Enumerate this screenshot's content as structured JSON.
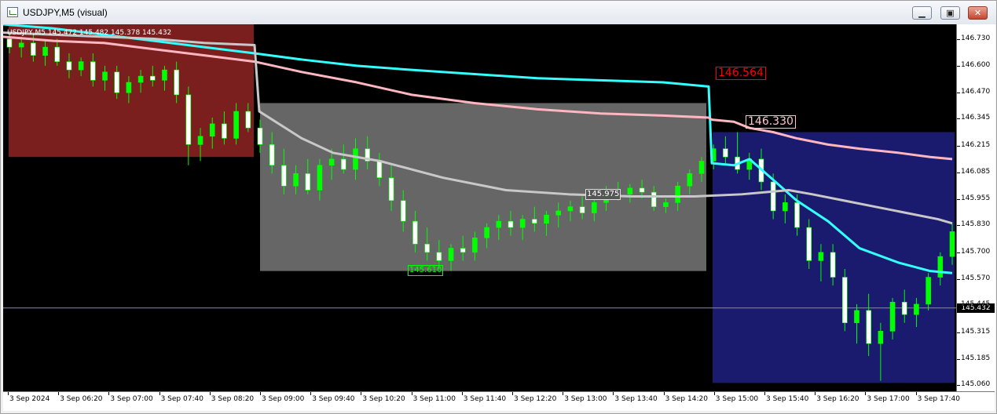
{
  "window": {
    "title": "USDJPY,M5 (visual)",
    "minimize": "▁",
    "restore": "▣",
    "close": "✕"
  },
  "chart": {
    "header": "USDJPY,M5  145.472 145.482 145.378 145.432",
    "current_price": "145.432",
    "labels": {
      "high_left": "146.564",
      "high_right": "146.330",
      "mid": "145.975",
      "low": "145.610"
    }
  },
  "colors": {
    "background": "#000000",
    "bull_candle": "#00ff00",
    "bear_candle": "#ffffff",
    "box_red": "#7a1e1e",
    "box_gray": "#666666",
    "box_blue": "#1a1a6e",
    "ma_cyan": "#33ffff",
    "ma_pink": "#ffb6c1",
    "ma_gray": "#c8c8c8",
    "label_red": "#ff0000"
  },
  "chart_data": {
    "type": "candlestick",
    "symbol": "USDJPY",
    "timeframe": "M5",
    "price_ticks": [
      "146.730",
      "146.600",
      "146.470",
      "146.345",
      "146.215",
      "146.085",
      "145.955",
      "145.830",
      "145.700",
      "145.570",
      "145.445",
      "145.315",
      "145.185",
      "145.060"
    ],
    "time_ticks": [
      "3 Sep 2024",
      "3 Sep 06:20",
      "3 Sep 07:00",
      "3 Sep 07:40",
      "3 Sep 08:20",
      "3 Sep 09:00",
      "3 Sep 09:40",
      "3 Sep 10:20",
      "3 Sep 11:00",
      "3 Sep 11:40",
      "3 Sep 12:20",
      "3 Sep 13:00",
      "3 Sep 13:40",
      "3 Sep 14:20",
      "3 Sep 15:00",
      "3 Sep 15:40",
      "3 Sep 16:20",
      "3 Sep 17:00",
      "3 Sep 17:40"
    ],
    "ylim": [
      145.03,
      146.8
    ],
    "current_price": 145.432,
    "levels": {
      "high_left": 146.564,
      "high_right": 146.33,
      "mid": 145.975,
      "low": 145.61
    },
    "series": [
      {
        "name": "cyan MA",
        "values": [
          146.8,
          146.78,
          146.75,
          146.72,
          146.69,
          146.66,
          146.63,
          146.6,
          146.58,
          146.56,
          146.54,
          146.53,
          146.52,
          146.5,
          146.13,
          146.12,
          146.15,
          146.05,
          145.95,
          145.85,
          145.72,
          145.65,
          145.61,
          145.6
        ]
      },
      {
        "name": "pink MA",
        "values": [
          146.74,
          146.72,
          146.71,
          146.68,
          146.65,
          146.62,
          146.57,
          146.52,
          146.46,
          146.42,
          146.39,
          146.37,
          146.36,
          146.35,
          146.34,
          146.33,
          146.3,
          146.28,
          146.25,
          146.22,
          146.2,
          146.18,
          146.16,
          146.15
        ]
      },
      {
        "name": "gray MA",
        "values": [
          146.76,
          146.75,
          146.74,
          146.73,
          146.71,
          146.7,
          146.38,
          146.25,
          146.18,
          146.14,
          146.06,
          146.0,
          145.98,
          145.97,
          145.97,
          145.98,
          145.99,
          146.0,
          145.98,
          145.95,
          145.92,
          145.89,
          145.86,
          145.84
        ]
      }
    ],
    "candles": [
      {
        "o": 146.73,
        "h": 146.76,
        "l": 146.66,
        "c": 146.69
      },
      {
        "o": 146.69,
        "h": 146.74,
        "l": 146.64,
        "c": 146.71
      },
      {
        "o": 146.71,
        "h": 146.75,
        "l": 146.62,
        "c": 146.65
      },
      {
        "o": 146.65,
        "h": 146.72,
        "l": 146.6,
        "c": 146.69
      },
      {
        "o": 146.69,
        "h": 146.73,
        "l": 146.6,
        "c": 146.62
      },
      {
        "o": 146.62,
        "h": 146.66,
        "l": 146.54,
        "c": 146.58
      },
      {
        "o": 146.58,
        "h": 146.64,
        "l": 146.55,
        "c": 146.62
      },
      {
        "o": 146.62,
        "h": 146.66,
        "l": 146.5,
        "c": 146.53
      },
      {
        "o": 146.53,
        "h": 146.6,
        "l": 146.48,
        "c": 146.57
      },
      {
        "o": 146.57,
        "h": 146.6,
        "l": 146.44,
        "c": 146.47
      },
      {
        "o": 146.47,
        "h": 146.55,
        "l": 146.42,
        "c": 146.52
      },
      {
        "o": 146.52,
        "h": 146.58,
        "l": 146.47,
        "c": 146.55
      },
      {
        "o": 146.55,
        "h": 146.6,
        "l": 146.5,
        "c": 146.53
      },
      {
        "o": 146.53,
        "h": 146.6,
        "l": 146.48,
        "c": 146.58
      },
      {
        "o": 146.58,
        "h": 146.62,
        "l": 146.42,
        "c": 146.46
      },
      {
        "o": 146.46,
        "h": 146.5,
        "l": 146.12,
        "c": 146.22
      },
      {
        "o": 146.22,
        "h": 146.3,
        "l": 146.14,
        "c": 146.26
      },
      {
        "o": 146.26,
        "h": 146.35,
        "l": 146.2,
        "c": 146.32
      },
      {
        "o": 146.32,
        "h": 146.38,
        "l": 146.22,
        "c": 146.25
      },
      {
        "o": 146.25,
        "h": 146.42,
        "l": 146.22,
        "c": 146.38
      },
      {
        "o": 146.38,
        "h": 146.42,
        "l": 146.28,
        "c": 146.3
      },
      {
        "o": 146.3,
        "h": 146.34,
        "l": 146.18,
        "c": 146.22
      },
      {
        "o": 146.22,
        "h": 146.28,
        "l": 146.08,
        "c": 146.12
      },
      {
        "o": 146.12,
        "h": 146.2,
        "l": 145.98,
        "c": 146.02
      },
      {
        "o": 146.02,
        "h": 146.12,
        "l": 145.98,
        "c": 146.08
      },
      {
        "o": 146.08,
        "h": 146.15,
        "l": 145.98,
        "c": 146.0
      },
      {
        "o": 146.0,
        "h": 146.15,
        "l": 145.95,
        "c": 146.12
      },
      {
        "o": 146.12,
        "h": 146.2,
        "l": 146.05,
        "c": 146.15
      },
      {
        "o": 146.15,
        "h": 146.22,
        "l": 146.08,
        "c": 146.1
      },
      {
        "o": 146.1,
        "h": 146.25,
        "l": 146.05,
        "c": 146.2
      },
      {
        "o": 146.2,
        "h": 146.26,
        "l": 146.1,
        "c": 146.14
      },
      {
        "o": 146.14,
        "h": 146.18,
        "l": 146.02,
        "c": 146.06
      },
      {
        "o": 146.06,
        "h": 146.12,
        "l": 145.9,
        "c": 145.95
      },
      {
        "o": 145.95,
        "h": 146.0,
        "l": 145.8,
        "c": 145.85
      },
      {
        "o": 145.85,
        "h": 145.9,
        "l": 145.7,
        "c": 145.74
      },
      {
        "o": 145.74,
        "h": 145.82,
        "l": 145.66,
        "c": 145.7
      },
      {
        "o": 145.7,
        "h": 145.76,
        "l": 145.62,
        "c": 145.66
      },
      {
        "o": 145.66,
        "h": 145.74,
        "l": 145.61,
        "c": 145.72
      },
      {
        "o": 145.72,
        "h": 145.78,
        "l": 145.66,
        "c": 145.7
      },
      {
        "o": 145.7,
        "h": 145.8,
        "l": 145.66,
        "c": 145.77
      },
      {
        "o": 145.77,
        "h": 145.84,
        "l": 145.72,
        "c": 145.82
      },
      {
        "o": 145.82,
        "h": 145.88,
        "l": 145.76,
        "c": 145.85
      },
      {
        "o": 145.85,
        "h": 145.9,
        "l": 145.78,
        "c": 145.82
      },
      {
        "o": 145.82,
        "h": 145.88,
        "l": 145.76,
        "c": 145.86
      },
      {
        "o": 145.86,
        "h": 145.92,
        "l": 145.8,
        "c": 145.84
      },
      {
        "o": 145.84,
        "h": 145.9,
        "l": 145.78,
        "c": 145.88
      },
      {
        "o": 145.88,
        "h": 145.94,
        "l": 145.82,
        "c": 145.9
      },
      {
        "o": 145.9,
        "h": 145.95,
        "l": 145.85,
        "c": 145.92
      },
      {
        "o": 145.92,
        "h": 145.97,
        "l": 145.86,
        "c": 145.89
      },
      {
        "o": 145.89,
        "h": 145.96,
        "l": 145.85,
        "c": 145.94
      },
      {
        "o": 145.94,
        "h": 146.02,
        "l": 145.9,
        "c": 146.0
      },
      {
        "o": 146.0,
        "h": 146.04,
        "l": 145.95,
        "c": 145.98
      },
      {
        "o": 145.98,
        "h": 146.03,
        "l": 145.94,
        "c": 146.01
      },
      {
        "o": 146.01,
        "h": 146.05,
        "l": 145.96,
        "c": 145.99
      },
      {
        "o": 145.99,
        "h": 146.02,
        "l": 145.9,
        "c": 145.92
      },
      {
        "o": 145.92,
        "h": 145.96,
        "l": 145.89,
        "c": 145.94
      },
      {
        "o": 145.94,
        "h": 146.04,
        "l": 145.9,
        "c": 146.02
      },
      {
        "o": 146.02,
        "h": 146.1,
        "l": 145.98,
        "c": 146.08
      },
      {
        "o": 146.08,
        "h": 146.16,
        "l": 146.04,
        "c": 146.14
      },
      {
        "o": 146.14,
        "h": 146.22,
        "l": 146.1,
        "c": 146.2
      },
      {
        "o": 146.2,
        "h": 146.26,
        "l": 146.12,
        "c": 146.16
      },
      {
        "o": 146.16,
        "h": 146.28,
        "l": 146.08,
        "c": 146.1
      },
      {
        "o": 146.1,
        "h": 146.18,
        "l": 146.05,
        "c": 146.15
      },
      {
        "o": 146.15,
        "h": 146.2,
        "l": 146.0,
        "c": 146.04
      },
      {
        "o": 146.04,
        "h": 146.08,
        "l": 145.86,
        "c": 145.9
      },
      {
        "o": 145.9,
        "h": 145.98,
        "l": 145.84,
        "c": 145.94
      },
      {
        "o": 145.94,
        "h": 145.98,
        "l": 145.78,
        "c": 145.82
      },
      {
        "o": 145.82,
        "h": 145.86,
        "l": 145.62,
        "c": 145.66
      },
      {
        "o": 145.66,
        "h": 145.74,
        "l": 145.56,
        "c": 145.7
      },
      {
        "o": 145.7,
        "h": 145.74,
        "l": 145.54,
        "c": 145.58
      },
      {
        "o": 145.58,
        "h": 145.62,
        "l": 145.32,
        "c": 145.36
      },
      {
        "o": 145.36,
        "h": 145.45,
        "l": 145.26,
        "c": 145.42
      },
      {
        "o": 145.42,
        "h": 145.5,
        "l": 145.2,
        "c": 145.26
      },
      {
        "o": 145.26,
        "h": 145.36,
        "l": 145.08,
        "c": 145.32
      },
      {
        "o": 145.32,
        "h": 145.48,
        "l": 145.28,
        "c": 145.46
      },
      {
        "o": 145.46,
        "h": 145.52,
        "l": 145.36,
        "c": 145.4
      },
      {
        "o": 145.4,
        "h": 145.48,
        "l": 145.34,
        "c": 145.45
      },
      {
        "o": 145.45,
        "h": 145.6,
        "l": 145.42,
        "c": 145.58
      },
      {
        "o": 145.58,
        "h": 145.7,
        "l": 145.54,
        "c": 145.68
      },
      {
        "o": 145.68,
        "h": 145.84,
        "l": 145.64,
        "c": 145.8
      }
    ]
  }
}
